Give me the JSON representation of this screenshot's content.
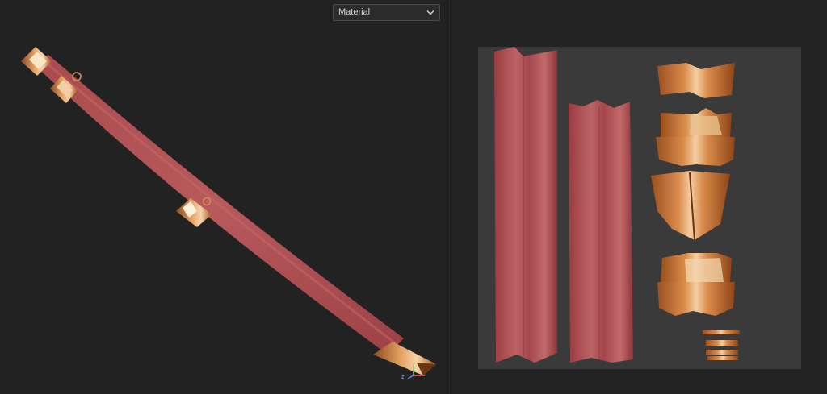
{
  "viewport": {
    "material_select": {
      "value": "Material"
    },
    "axis_gizmo": {
      "z_label": "z"
    }
  },
  "colors": {
    "background": "#222222",
    "leather": "#b04f52",
    "copper": "#c8763a",
    "uv_sheet": "#3a3a3a"
  }
}
